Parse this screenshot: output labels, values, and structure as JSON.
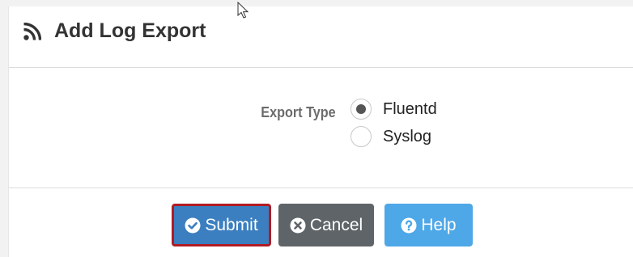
{
  "header": {
    "icon": "rss-icon",
    "title": "Add Log Export"
  },
  "form": {
    "export_type_label": "Export Type",
    "options": [
      {
        "label": "Fluentd",
        "selected": true
      },
      {
        "label": "Syslog",
        "selected": false
      }
    ]
  },
  "buttons": {
    "submit": {
      "label": "Submit",
      "icon": "check-circle-icon",
      "color": "#3b7fc0",
      "focus_border": "#b11b22"
    },
    "cancel": {
      "label": "Cancel",
      "icon": "times-circle-icon",
      "color": "#5f6468"
    },
    "help": {
      "label": "Help",
      "icon": "question-circle-icon",
      "color": "#4ea7e6"
    }
  }
}
